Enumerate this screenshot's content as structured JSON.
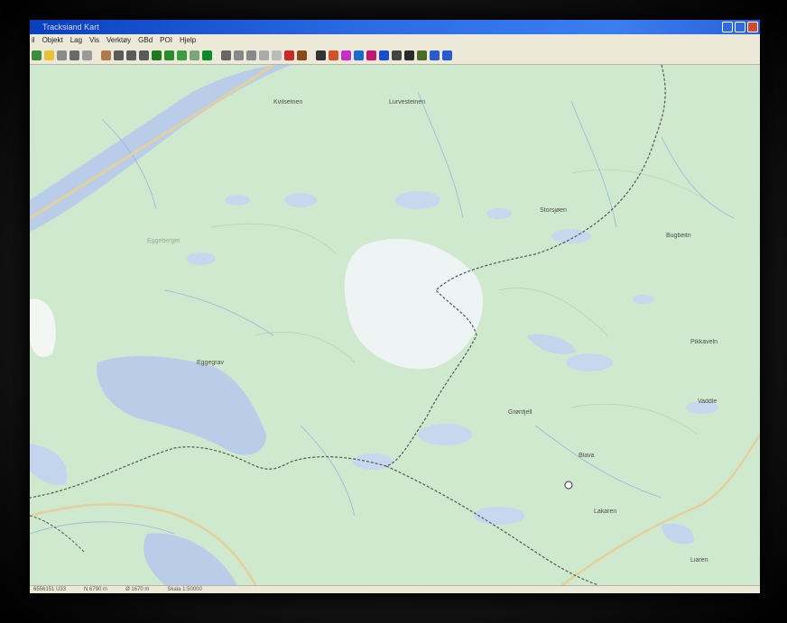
{
  "window": {
    "title": "Tracksiand Kart",
    "controls": [
      "minimize-icon",
      "maximize-icon",
      "close-icon"
    ]
  },
  "menu": {
    "items": [
      "il",
      "Objekt",
      "Lag",
      "Vis",
      "Verktøy",
      "GBd",
      "POI",
      "Hjelp"
    ]
  },
  "toolbar": {
    "buttons": [
      {
        "icon": "home-icon",
        "color": "#3c8a3c"
      },
      {
        "icon": "cursor-icon",
        "color": "#e8c23a"
      },
      {
        "icon": "info-icon",
        "color": "#8a8a8a"
      },
      {
        "icon": "measure-icon",
        "color": "#6a6a6a"
      },
      {
        "icon": "grid-icon",
        "color": "#9a9a9a"
      },
      {
        "icon": "hand-icon",
        "color": "#b07a4a"
      },
      {
        "icon": "zoom-in-icon",
        "color": "#5a5a5a"
      },
      {
        "icon": "zoom-out-icon",
        "color": "#5a5a5a"
      },
      {
        "icon": "zoom-area-icon",
        "color": "#5a5a5a"
      },
      {
        "icon": "layer-green-icon",
        "color": "#1d7a1d"
      },
      {
        "icon": "layer-green2-icon",
        "color": "#2b8a2b"
      },
      {
        "icon": "page-icon",
        "color": "#3e9b3e"
      },
      {
        "icon": "page2-icon",
        "color": "#7aa77a"
      },
      {
        "icon": "table-icon",
        "color": "#0c8a2c"
      },
      {
        "icon": "route-icon",
        "color": "#666666"
      },
      {
        "icon": "chat-icon",
        "color": "#888888"
      },
      {
        "icon": "print-icon",
        "color": "#888888"
      },
      {
        "icon": "circle-grey-icon",
        "color": "#aaaaaa"
      },
      {
        "icon": "circle-grey2-icon",
        "color": "#bbbbbb"
      },
      {
        "icon": "record-icon",
        "color": "#cc2a2a"
      },
      {
        "icon": "gps-icon",
        "color": "#8a4a1a"
      },
      {
        "icon": "arrow-up-icon",
        "color": "#333333"
      },
      {
        "icon": "ball-icon",
        "color": "#d2512a"
      },
      {
        "icon": "target-icon",
        "color": "#c62ec6"
      },
      {
        "icon": "photo-icon",
        "color": "#1a6acf"
      },
      {
        "icon": "stop-icon",
        "color": "#c2186e"
      },
      {
        "icon": "flag-icon",
        "color": "#1a4ad0"
      },
      {
        "icon": "link-icon",
        "color": "#444444"
      },
      {
        "icon": "car-icon",
        "color": "#2a2a2a"
      },
      {
        "icon": "bag-icon",
        "color": "#4a6a2a"
      },
      {
        "icon": "monitor-icon",
        "color": "#2a5ad0"
      },
      {
        "icon": "window-icon",
        "color": "#2a5ad0"
      }
    ]
  },
  "map": {
    "background": "#cfe9cf",
    "water_color": "#b9cde9",
    "road_color": "#e4d09a",
    "labels": [
      {
        "text": "Kvilsetnen"
      },
      {
        "text": "Lurvesteinen"
      },
      {
        "text": "Storsjøen"
      },
      {
        "text": "Eggeberget"
      },
      {
        "text": "Bugbeitn"
      },
      {
        "text": "Pikkaveln"
      },
      {
        "text": "Grønfjell"
      },
      {
        "text": "Vaddle"
      },
      {
        "text": "Blava"
      },
      {
        "text": "Lakaren"
      },
      {
        "text": "Liaren"
      },
      {
        "text": "Eggegrav"
      }
    ]
  },
  "status": {
    "items": [
      "6556151 U33",
      "N 6790 m",
      "Ø 1670 m",
      "Skala 1:50000"
    ]
  }
}
